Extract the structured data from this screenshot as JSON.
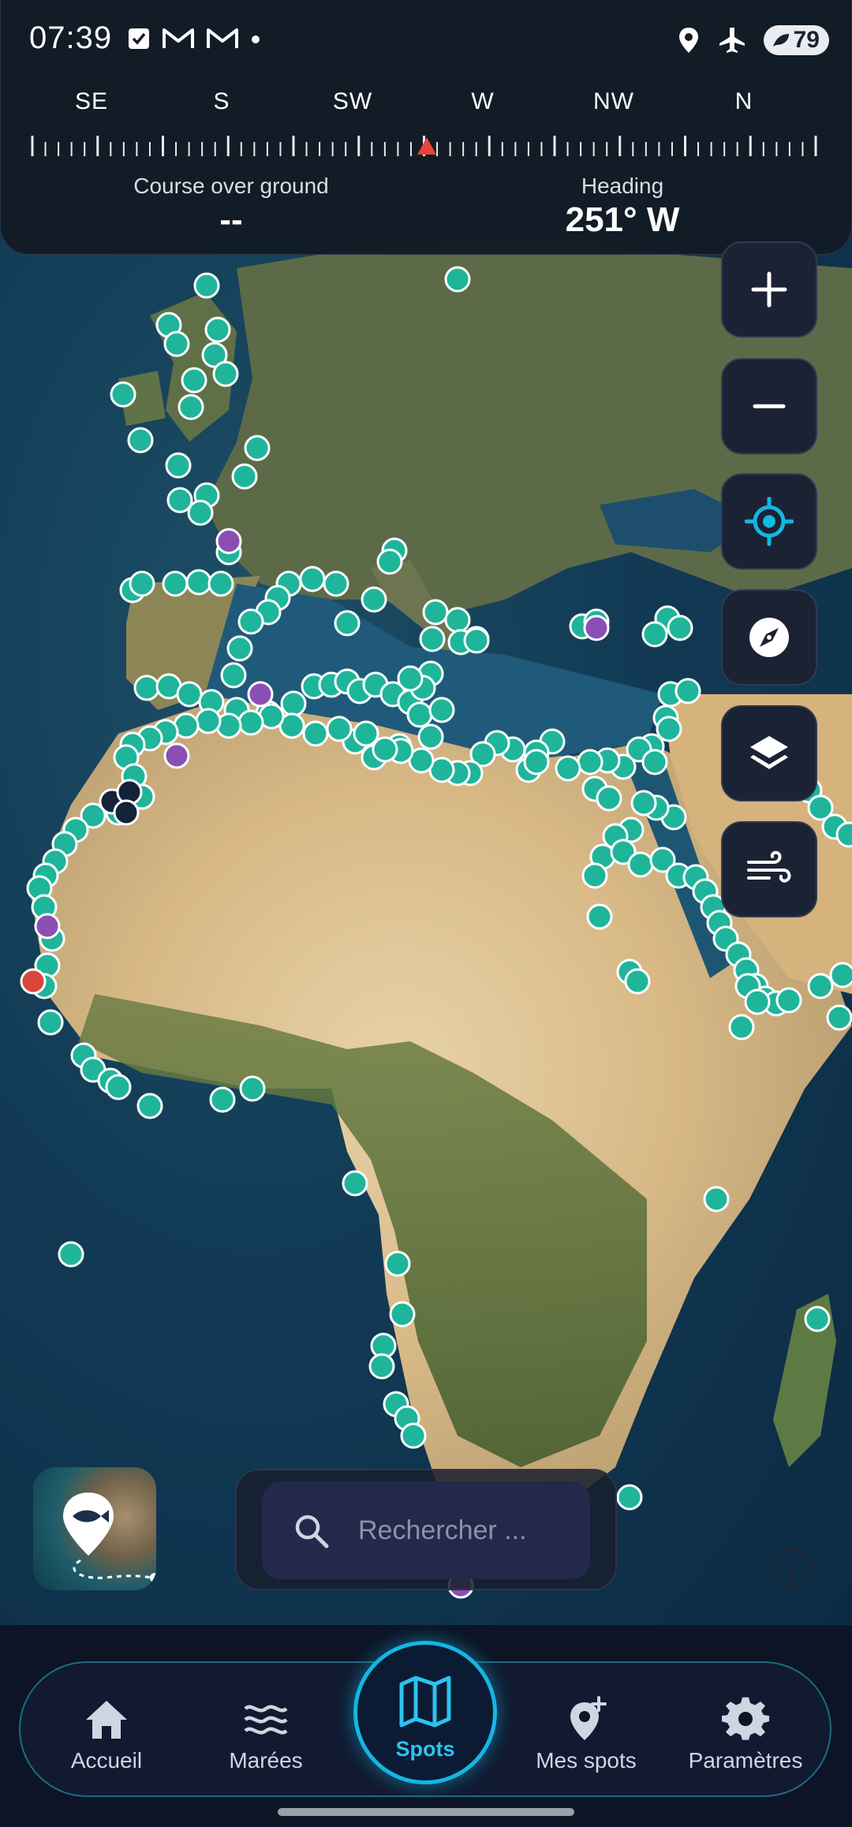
{
  "status_bar": {
    "time": "07:39",
    "battery": "79",
    "icons_left": [
      "checkbox-icon",
      "gmail-icon",
      "gmail-icon",
      "dot-icon"
    ],
    "icons_right": [
      "location-icon",
      "airplane-mode-icon",
      "battery-icon"
    ]
  },
  "compass": {
    "directions": [
      "SE",
      "S",
      "SW",
      "W",
      "NW",
      "N"
    ],
    "pointer_color": "#e5443a",
    "course_label": "Course over ground",
    "course_value": "--",
    "heading_label": "Heading",
    "heading_value": "251° W"
  },
  "map_controls": [
    {
      "name": "zoom-in",
      "icon": "plus-icon"
    },
    {
      "name": "zoom-out",
      "icon": "minus-icon"
    },
    {
      "name": "my-location",
      "icon": "crosshair-icon"
    },
    {
      "name": "compass-mode",
      "icon": "compass-icon"
    },
    {
      "name": "layers",
      "icon": "layers-icon"
    },
    {
      "name": "wind",
      "icon": "wind-icon"
    }
  ],
  "search": {
    "placeholder": "Rechercher ..."
  },
  "colors": {
    "spot_marker": "#1fb59a",
    "spot_marker_purple": "#8b4fb3",
    "spot_marker_navy": "#14223a",
    "accent": "#14b6e2"
  },
  "nav": {
    "items": [
      {
        "label": "Accueil",
        "icon": "home-icon"
      },
      {
        "label": "Marées",
        "icon": "waves-icon"
      },
      {
        "label": "Spots",
        "icon": "map-icon",
        "active": true
      },
      {
        "label": "Mes spots",
        "icon": "add-location-icon"
      },
      {
        "label": "Paramètres",
        "icon": "gear-icon"
      }
    ]
  }
}
